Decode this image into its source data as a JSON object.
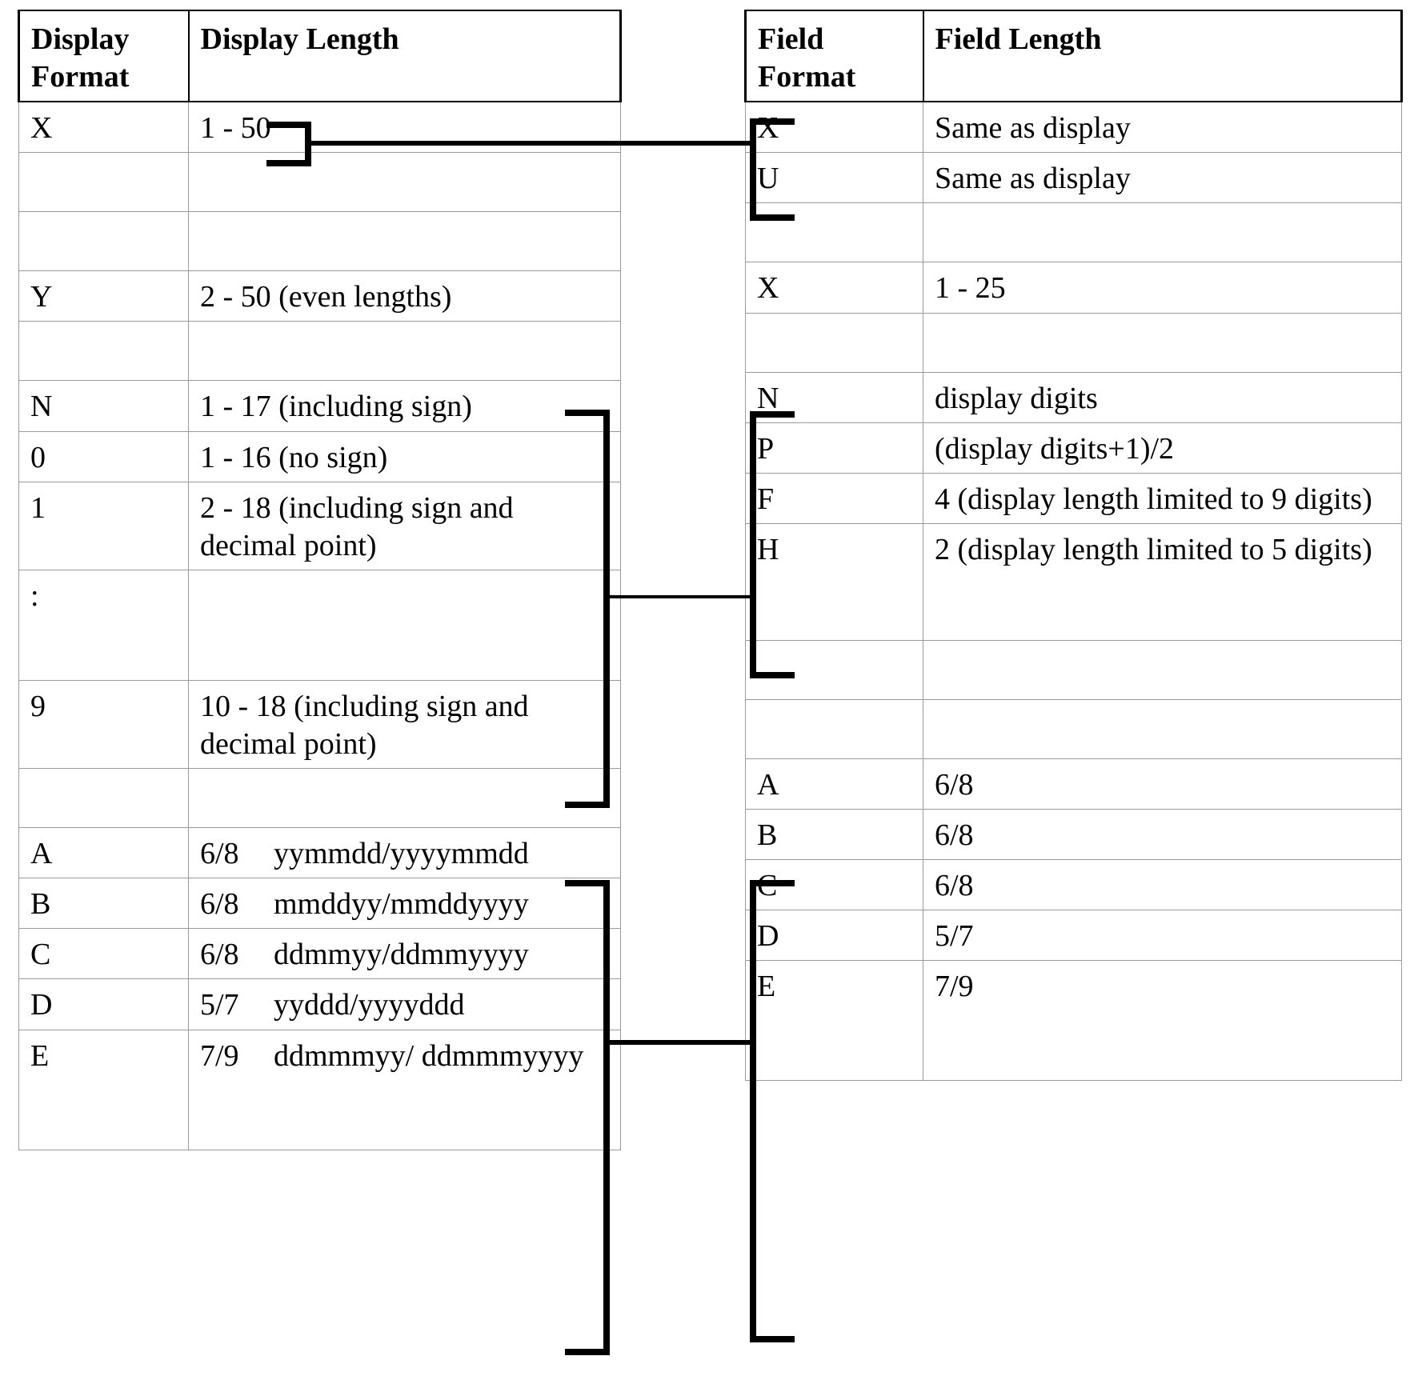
{
  "left_table": {
    "headers": [
      "Display Format",
      "Display Length"
    ],
    "rows": [
      {
        "format": "X",
        "length": "1 - 50",
        "blank": false
      },
      {
        "format": "",
        "length": "",
        "blank": true
      },
      {
        "format": "",
        "length": "",
        "blank": true
      },
      {
        "format": "Y",
        "length": "2 - 50 (even lengths)",
        "blank": false
      },
      {
        "format": "",
        "length": "",
        "blank": true
      },
      {
        "format": "N",
        "length": "1 - 17 (including sign)",
        "blank": false
      },
      {
        "format": "0",
        "length": "1 - 16 (no sign)",
        "blank": false
      },
      {
        "format": "1",
        "length": "2 - 18 (including sign and decimal point)",
        "blank": false
      },
      {
        "format": ":",
        "length": "",
        "blank": false
      },
      {
        "format": "9",
        "length": "10 - 18 (including sign and decimal point)",
        "blank": false
      },
      {
        "format": "",
        "length": "",
        "blank": true
      },
      {
        "format": "A",
        "length_num": "6/8",
        "length_pattern": "yymmdd/yyyymmdd",
        "blank": false
      },
      {
        "format": "B",
        "length_num": "6/8",
        "length_pattern": "mmddyy/mmddyyyy",
        "blank": false
      },
      {
        "format": "C",
        "length_num": "6/8",
        "length_pattern": "ddmmyy/ddmmyyyy",
        "blank": false
      },
      {
        "format": "D",
        "length_num": "5/7",
        "length_pattern": "yyddd/yyyyddd",
        "blank": false
      },
      {
        "format": "E",
        "length_num": "7/9",
        "length_pattern": "ddmmmyy/ ddmmmyyyy",
        "blank": false
      }
    ]
  },
  "right_table": {
    "headers": [
      "Field Format",
      "Field Length"
    ],
    "rows": [
      {
        "format": "X",
        "length": "Same as display",
        "blank": false
      },
      {
        "format": "U",
        "length": "Same as display",
        "blank": false
      },
      {
        "format": "",
        "length": "",
        "blank": true
      },
      {
        "format": "X",
        "length": "1 - 25",
        "blank": false
      },
      {
        "format": "",
        "length": "",
        "blank": true
      },
      {
        "format": "N",
        "length": "display digits",
        "blank": false
      },
      {
        "format": "P",
        "length": "(display digits+1)/2",
        "blank": false
      },
      {
        "format": "F",
        "length": "4 (display length limited to 9 digits)",
        "blank": false
      },
      {
        "format": "H",
        "length": "2 (display length limited to 5 digits)",
        "blank": false
      },
      {
        "format": "",
        "length": "",
        "blank": true
      },
      {
        "format": "",
        "length": "",
        "blank": true
      },
      {
        "format": "A",
        "length": "6/8",
        "blank": false
      },
      {
        "format": "B",
        "length": "6/8",
        "blank": false
      },
      {
        "format": "C",
        "length": "6/8",
        "blank": false
      },
      {
        "format": "D",
        "length": "5/7",
        "blank": false
      },
      {
        "format": "E",
        "length": "7/9",
        "blank": false
      }
    ]
  },
  "connectors": [
    {
      "name": "character-group",
      "from": "X (1 - 50)",
      "to": "X / U"
    },
    {
      "name": "numeric-group",
      "from": "N / 0 / 1 / : / 9",
      "to": "N / P / F / H"
    },
    {
      "name": "date-group",
      "from": "A / B / C / D / E",
      "to": "A / B / C / D / E"
    }
  ],
  "colors": {
    "rule": "#9a9a9a",
    "frame": "#000000",
    "text": "#000000",
    "background": "#ffffff"
  }
}
